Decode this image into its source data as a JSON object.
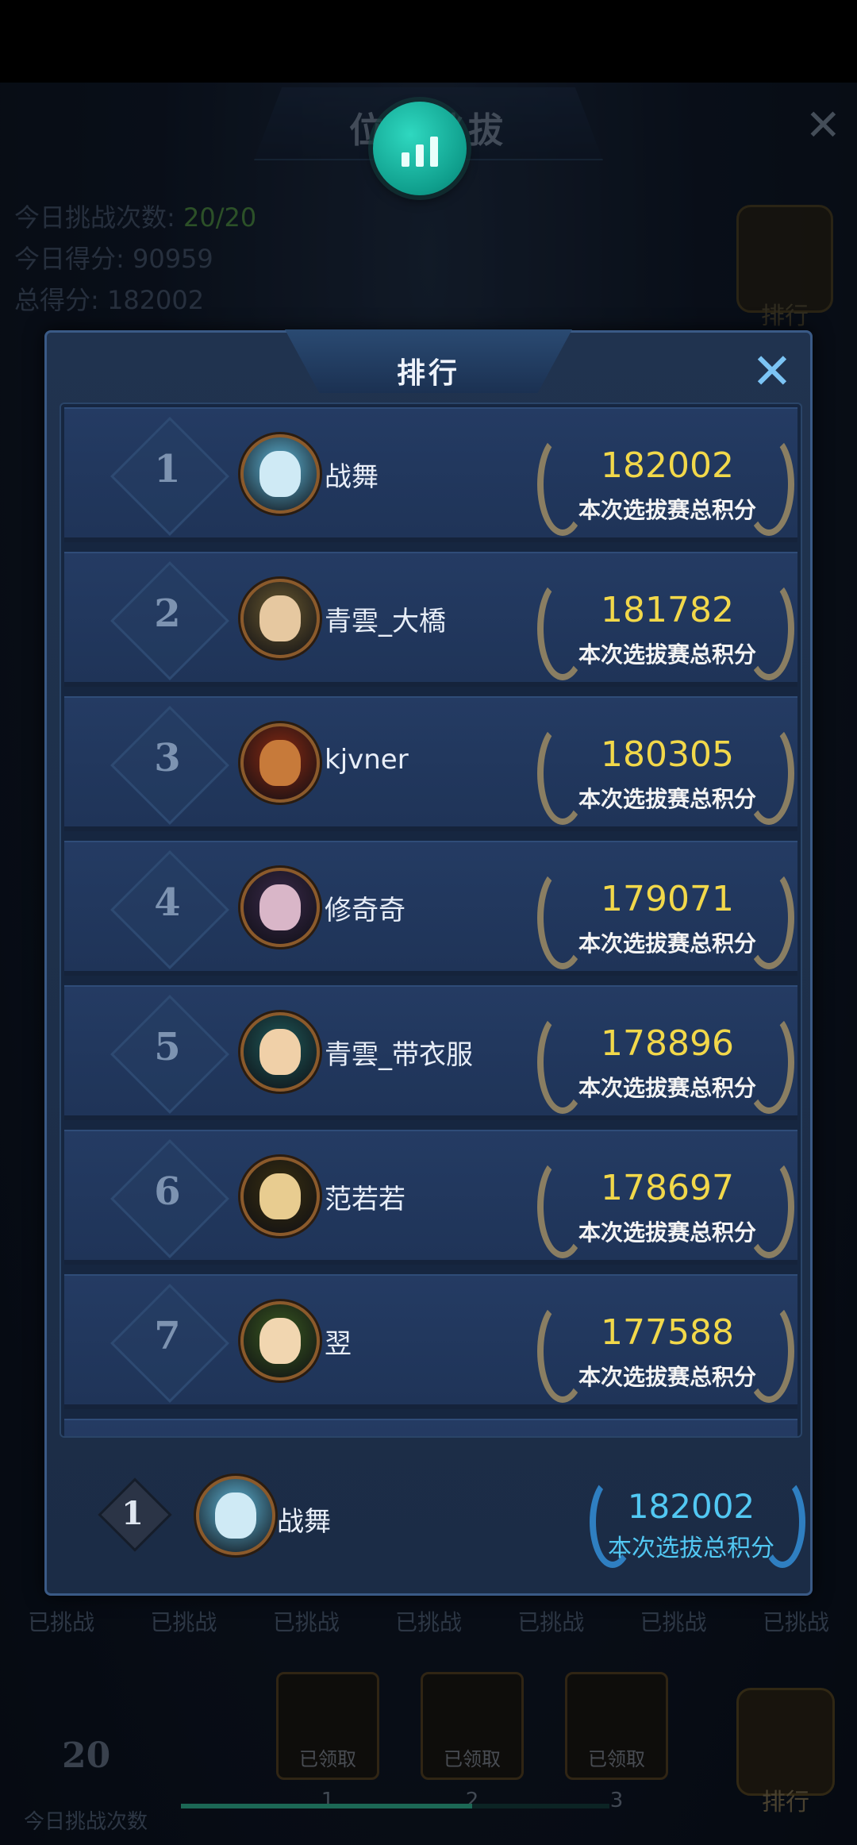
{
  "background": {
    "title": "位面挑拔",
    "stats": [
      {
        "label": "今日挑战次数: ",
        "value": "20/20"
      },
      {
        "label": "今日得分: ",
        "value": "90959"
      },
      {
        "label": "总得分: ",
        "value": "182002"
      }
    ],
    "rank_button_label": "排行",
    "bottom_labels": [
      "已挑战",
      "已挑战",
      "已挑战",
      "已挑战",
      "已挑战",
      "已挑战",
      "已挑战"
    ],
    "bottom_count": "20",
    "bottom_count_label": "今日挑战次数",
    "chests": [
      {
        "label": "已领取",
        "num": "1"
      },
      {
        "label": "已领取",
        "num": "2"
      },
      {
        "label": "已领取",
        "num": "3"
      }
    ],
    "progress": 0.68,
    "trophy_label": "排行"
  },
  "modal": {
    "title": "排行",
    "score_label": "本次选拔赛总积分",
    "rows": [
      {
        "rank": "1",
        "name": "战舞",
        "score": "182002",
        "avatar": "#5fb7d8",
        "face": "#cfeaf5"
      },
      {
        "rank": "2",
        "name": "青雲_大橋",
        "score": "181782",
        "avatar": "#6a5a30",
        "face": "#e6c8a0"
      },
      {
        "rank": "3",
        "name": "kjvner",
        "score": "180305",
        "avatar": "#8a2a12",
        "face": "#c77a3a"
      },
      {
        "rank": "4",
        "name": "修奇奇",
        "score": "179071",
        "avatar": "#3a2a4a",
        "face": "#d9b6c8"
      },
      {
        "rank": "5",
        "name": "青雲_带衣服",
        "score": "178896",
        "avatar": "#1f5a5a",
        "face": "#f0d0a8"
      },
      {
        "rank": "6",
        "name": "范若若",
        "score": "178697",
        "avatar": "#3a3010",
        "face": "#e8cc90"
      },
      {
        "rank": "7",
        "name": "翌",
        "score": "177588",
        "avatar": "#3a5a20",
        "face": "#f1d6b0"
      }
    ],
    "mine": {
      "rank": "1",
      "name": "战舞",
      "score": "182002",
      "score_label": "本次选拔总积分",
      "avatar": "#5fb7d8",
      "face": "#cfeaf5"
    }
  },
  "colors": {
    "score": "#f2d84a",
    "my_score": "#52c8f3",
    "fab": "#16b3a0"
  }
}
